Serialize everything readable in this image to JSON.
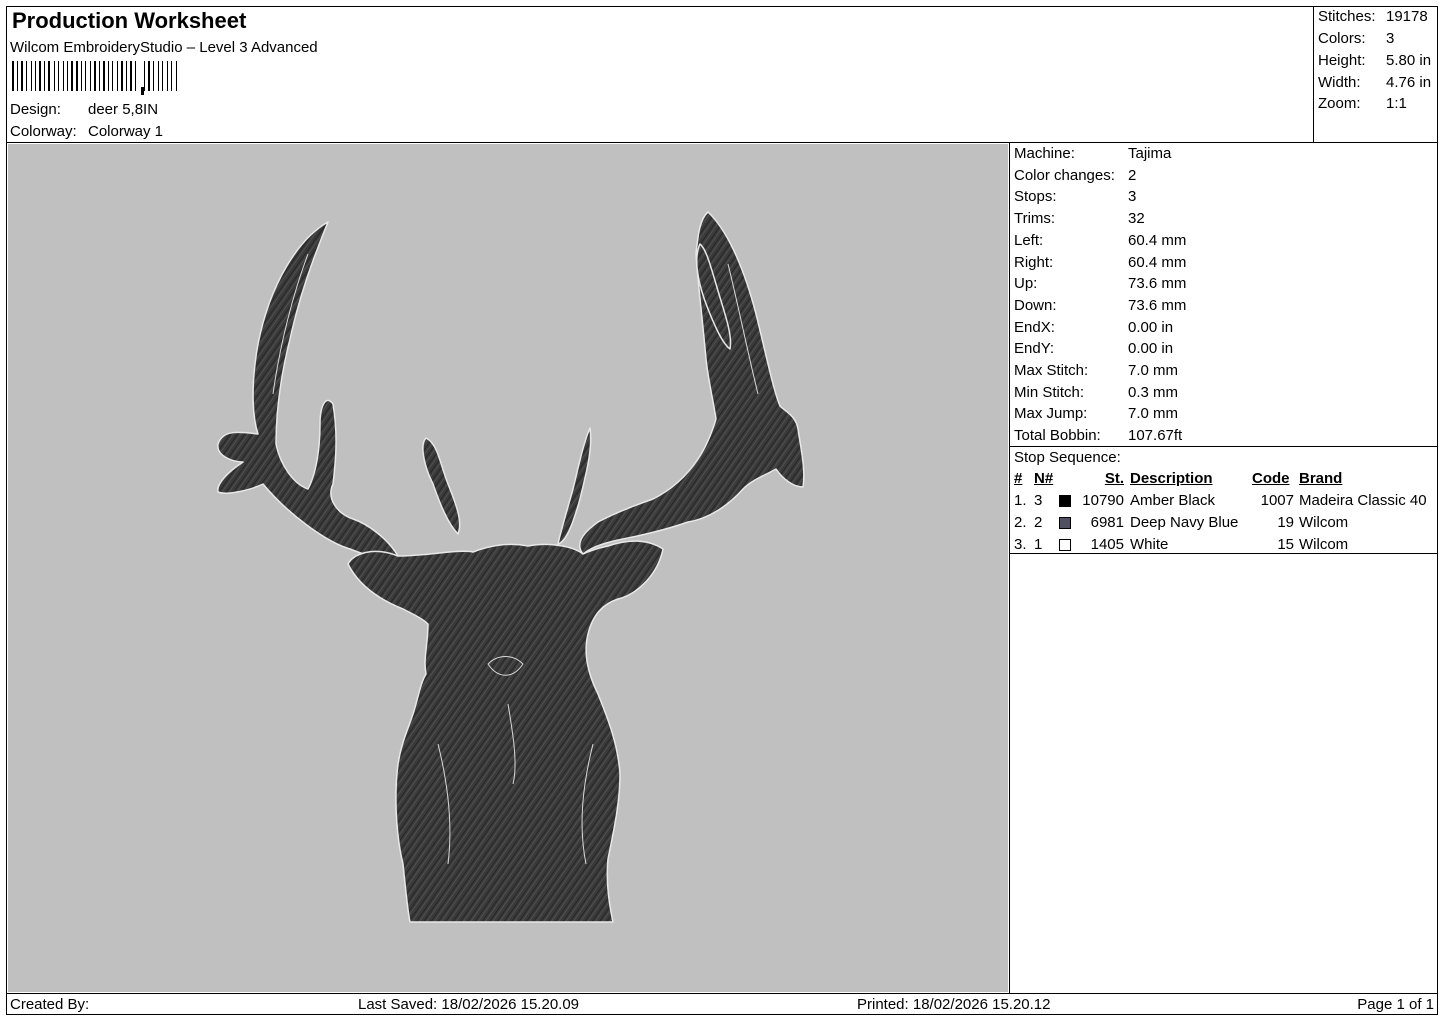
{
  "header": {
    "title": "Production Worksheet",
    "subtitle": "Wilcom EmbroideryStudio – Level 3 Advanced",
    "design_label": "Design:",
    "design_value": "deer 5,8IN",
    "colorway_label": "Colorway:",
    "colorway_value": "Colorway 1"
  },
  "summary": {
    "stitches_label": "Stitches:",
    "stitches": "19178",
    "colors_label": "Colors:",
    "colors": "3",
    "height_label": "Height:",
    "height": "5.80 in",
    "width_label": "Width:",
    "width": "4.76 in",
    "zoom_label": "Zoom:",
    "zoom": "1:1"
  },
  "machine_info": [
    {
      "label": "Machine:",
      "value": "Tajima"
    },
    {
      "label": "Color changes:",
      "value": "2"
    },
    {
      "label": "Stops:",
      "value": "3"
    },
    {
      "label": "Trims:",
      "value": "32"
    },
    {
      "label": "Left:",
      "value": "60.4 mm"
    },
    {
      "label": "Right:",
      "value": "60.4 mm"
    },
    {
      "label": "Up:",
      "value": "73.6 mm"
    },
    {
      "label": "Down:",
      "value": "73.6 mm"
    },
    {
      "label": "EndX:",
      "value": "0.00 in"
    },
    {
      "label": "EndY:",
      "value": "0.00 in"
    },
    {
      "label": "Max Stitch:",
      "value": "7.0 mm"
    },
    {
      "label": "Min Stitch:",
      "value": "0.3 mm"
    },
    {
      "label": "Max Jump:",
      "value": "7.0 mm"
    },
    {
      "label": "Total Bobbin:",
      "value": "107.67ft"
    }
  ],
  "stop_sequence": {
    "title": "Stop Sequence:",
    "columns": {
      "num": "#",
      "n": "N#",
      "st": "St.",
      "desc": "Description",
      "code": "Code",
      "brand": "Brand"
    },
    "rows": [
      {
        "num": "1.",
        "n": "3",
        "color": "#000000",
        "st": "10790",
        "desc": "Amber Black",
        "code": "1007",
        "brand": "Madeira Classic 40"
      },
      {
        "num": "2.",
        "n": "2",
        "color": "#505060",
        "st": "6981",
        "desc": "Deep Navy Blue",
        "code": "19",
        "brand": "Wilcom"
      },
      {
        "num": "3.",
        "n": "1",
        "color": "#ffffff",
        "st": "1405",
        "desc": "White",
        "code": "15",
        "brand": "Wilcom"
      }
    ]
  },
  "footer": {
    "created_by": "Created By:",
    "last_saved": "Last Saved: 18/02/2026 15.20.09",
    "printed": "Printed: 18/02/2026 15.20.12",
    "page": "Page 1 of 1"
  },
  "preview": {
    "background": "#c0c0c0",
    "image": "deer-head-embroidery"
  }
}
